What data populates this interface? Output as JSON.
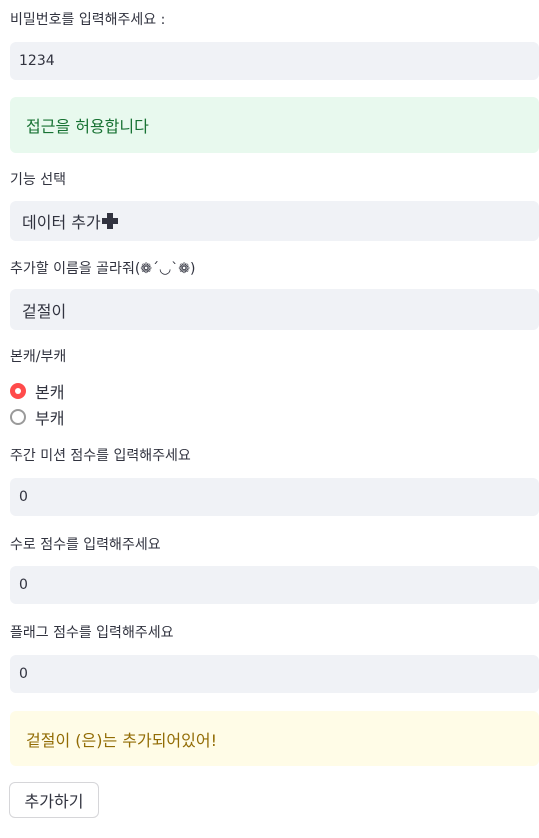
{
  "password": {
    "label": "비밀번호를 입력해주세요 :",
    "value": "1234"
  },
  "access_alert": "접근을 허용합니다",
  "function_select": {
    "label": "기능 선택",
    "value": "데이터 추가"
  },
  "name_select": {
    "label": "추가할 이름을 골라줘(❁´◡`❁)",
    "value": "겉절이"
  },
  "account_type": {
    "label": "본캐/부캐",
    "options": [
      "본캐",
      "부캐"
    ],
    "selected": "본캐"
  },
  "weekly_score": {
    "label": "주간 미션 점수를 입력해주세요",
    "value": "0"
  },
  "waterway_score": {
    "label": "수로 점수를 입력해주세요",
    "value": "0"
  },
  "flag_score": {
    "label": "플래그 점수를 입력해주세요",
    "value": "0"
  },
  "warning_alert": "겉절이 (은)는 추가되어있어!",
  "add_button": "추가하기",
  "colors": {
    "accent": "#ff4b4b",
    "input_bg": "#f0f2f6",
    "success_bg": "#e8f9ee",
    "success_text": "#177233",
    "warning_bg": "#fffce7",
    "warning_text": "#926c05"
  },
  "icons": {
    "add_marker": "plus-icon"
  }
}
